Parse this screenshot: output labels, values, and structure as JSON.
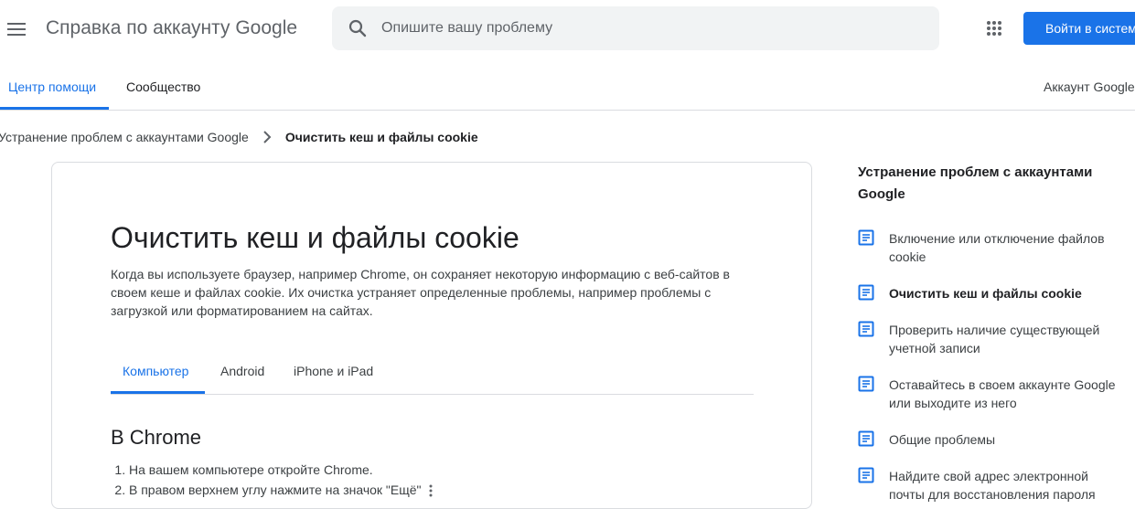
{
  "header": {
    "app_title": "Справка по аккаунту Google",
    "search_placeholder": "Опишите вашу проблему",
    "signin_label": "Войти в систему"
  },
  "nav": {
    "tabs": [
      {
        "label": "Центр помощи",
        "active": true
      },
      {
        "label": "Сообщество",
        "active": false
      }
    ],
    "account_link": "Аккаунт Google"
  },
  "breadcrumb": {
    "parent": "Устранение проблем с аккаунтами Google",
    "current": "Очистить кеш и файлы cookie"
  },
  "article": {
    "title": "Очистить кеш и файлы cookie",
    "intro": "Когда вы используете браузер, например Chrome, он сохраняет некоторую информацию с веб-сайтов в своем кеше и файлах cookie. Их очистка устраняет определенные проблемы, например проблемы с загрузкой или форматированием на сайтах.",
    "tabs": [
      {
        "label": "Компьютер",
        "active": true
      },
      {
        "label": "Android",
        "active": false
      },
      {
        "label": "iPhone и iPad",
        "active": false
      }
    ],
    "section_heading": "В Chrome",
    "steps": [
      "На вашем компьютере откройте Chrome.",
      "В правом верхнем углу нажмите на значок \"Ещё\""
    ]
  },
  "sidebar": {
    "title": "Устранение проблем с аккаунтами Google",
    "items": [
      {
        "label": "Включение или отключение файлов cookie",
        "current": false
      },
      {
        "label": "Очистить кеш и файлы cookie",
        "current": true
      },
      {
        "label": "Проверить наличие существующей учетной записи",
        "current": false
      },
      {
        "label": "Оставайтесь в своем аккаунте Google или выходите из него",
        "current": false
      },
      {
        "label": "Общие проблемы",
        "current": false
      },
      {
        "label": "Найдите свой адрес электронной почты для восстановления пароля",
        "current": false
      }
    ]
  },
  "colors": {
    "accent": "#1a73e8",
    "text_primary": "#202124",
    "text_secondary": "#5f6368",
    "search_bg": "#f1f3f4",
    "divider": "#dadce0"
  },
  "icons": {
    "menu": "hamburger-menu-icon",
    "search": "search-icon",
    "apps": "apps-grid-icon",
    "breadcrumb_separator": "chevron-right-icon",
    "article_link": "document-icon",
    "more": "more-vert-icon"
  }
}
